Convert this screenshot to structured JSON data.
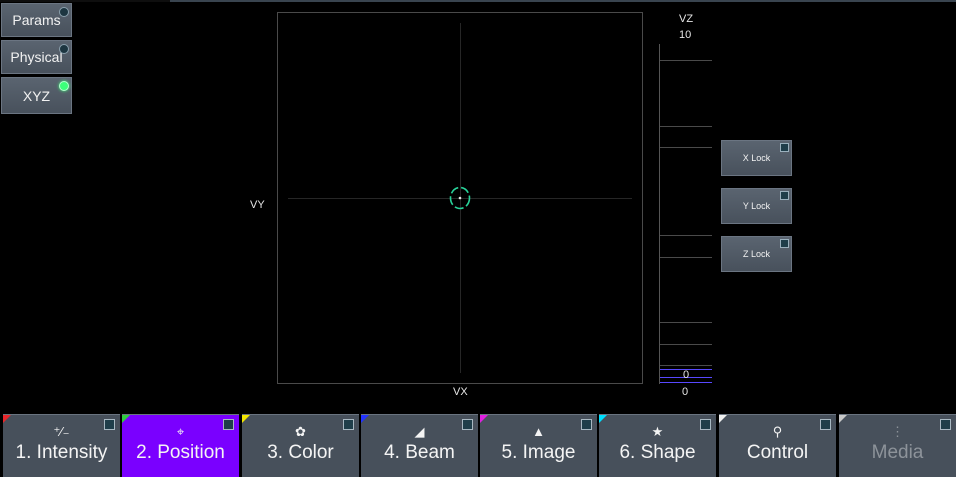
{
  "sidebar": {
    "items": [
      {
        "label": "Params",
        "led": "off"
      },
      {
        "label": "Physical",
        "led": "off"
      },
      {
        "label": "XYZ",
        "led": "on"
      }
    ]
  },
  "xy_pad": {
    "x_label": "VX",
    "y_label": "VY",
    "cursor_color": "#29d39a"
  },
  "z_fader": {
    "label": "VZ",
    "max_label": "10",
    "current_value": "0",
    "min_label": "0",
    "indicator_color": "#5848ff"
  },
  "locks": [
    {
      "label": "X Lock"
    },
    {
      "label": "Y Lock"
    },
    {
      "label": "Z Lock"
    }
  ],
  "tabs": [
    {
      "label": "1. Intensity",
      "icon": "intensity-icon",
      "glyph": "⁺∕₋",
      "corner": "#e8262a",
      "state": "normal"
    },
    {
      "label": "2. Position",
      "icon": "position-icon",
      "glyph": "⌖",
      "corner": "#2ecc40",
      "state": "active"
    },
    {
      "label": "3. Color",
      "icon": "color-palette-icon",
      "glyph": "✿",
      "corner": "#f2e600",
      "state": "normal"
    },
    {
      "label": "4. Beam",
      "icon": "beam-icon",
      "glyph": "◢",
      "corner": "#2233ff",
      "state": "normal"
    },
    {
      "label": "5. Image",
      "icon": "image-icon",
      "glyph": "▲",
      "corner": "#e020e0",
      "state": "normal"
    },
    {
      "label": "6. Shape",
      "icon": "star-icon",
      "glyph": "★",
      "corner": "#00e0ff",
      "state": "normal"
    },
    {
      "label": "Control",
      "icon": "control-icon",
      "glyph": "⚲",
      "corner": "#f0f0f0",
      "state": "normal"
    },
    {
      "label": "Media",
      "icon": "media-icon",
      "glyph": "⋮",
      "corner": "#c8c8c8",
      "state": "disabled"
    }
  ]
}
